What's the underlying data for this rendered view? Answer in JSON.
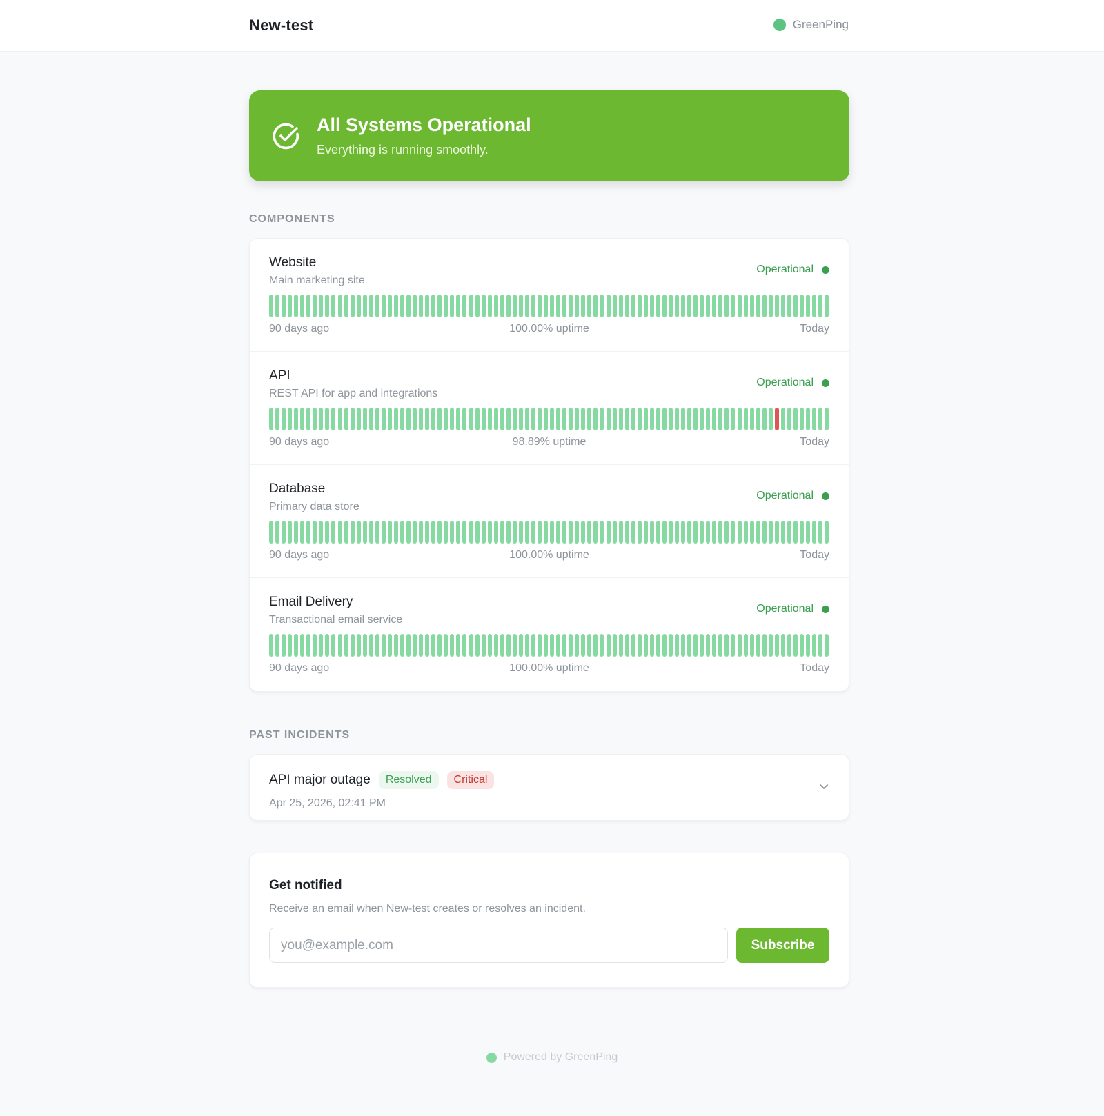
{
  "header": {
    "title": "New-test",
    "brand": "GreenPing"
  },
  "hero": {
    "title": "All Systems Operational",
    "subtitle": "Everything is running smoothly.",
    "icon": "check-circle-icon"
  },
  "sections": {
    "components_label": "COMPONENTS",
    "incidents_label": "PAST INCIDENTS"
  },
  "components": [
    {
      "name": "Website",
      "description": "Main marketing site",
      "status": "Operational",
      "uptime": "100.00% uptime",
      "range_start": "90 days ago",
      "range_end": "Today",
      "days": 90,
      "down_days": []
    },
    {
      "name": "API",
      "description": "REST API for app and integrations",
      "status": "Operational",
      "uptime": "98.89% uptime",
      "range_start": "90 days ago",
      "range_end": "Today",
      "days": 90,
      "down_days": [
        81
      ]
    },
    {
      "name": "Database",
      "description": "Primary data store",
      "status": "Operational",
      "uptime": "100.00% uptime",
      "range_start": "90 days ago",
      "range_end": "Today",
      "days": 90,
      "down_days": []
    },
    {
      "name": "Email Delivery",
      "description": "Transactional email service",
      "status": "Operational",
      "uptime": "100.00% uptime",
      "range_start": "90 days ago",
      "range_end": "Today",
      "days": 90,
      "down_days": []
    }
  ],
  "incidents": [
    {
      "title": "API major outage",
      "status_badge": "Resolved",
      "severity_badge": "Critical",
      "date": "Apr 25, 2026, 02:41 PM"
    }
  ],
  "notify": {
    "title": "Get notified",
    "description": "Receive an email when New-test creates or resolves an incident.",
    "email_placeholder": "you@example.com",
    "email_value": "",
    "subscribe_label": "Subscribe"
  },
  "footer": {
    "text": "Powered by GreenPing"
  },
  "colors": {
    "accent": "#6db831",
    "operational": "#3aa050",
    "bar_up": "#86d9a0",
    "bar_down": "#e05454",
    "brand_dot": "#5cc480",
    "footer_dot": "#86d9a0"
  }
}
